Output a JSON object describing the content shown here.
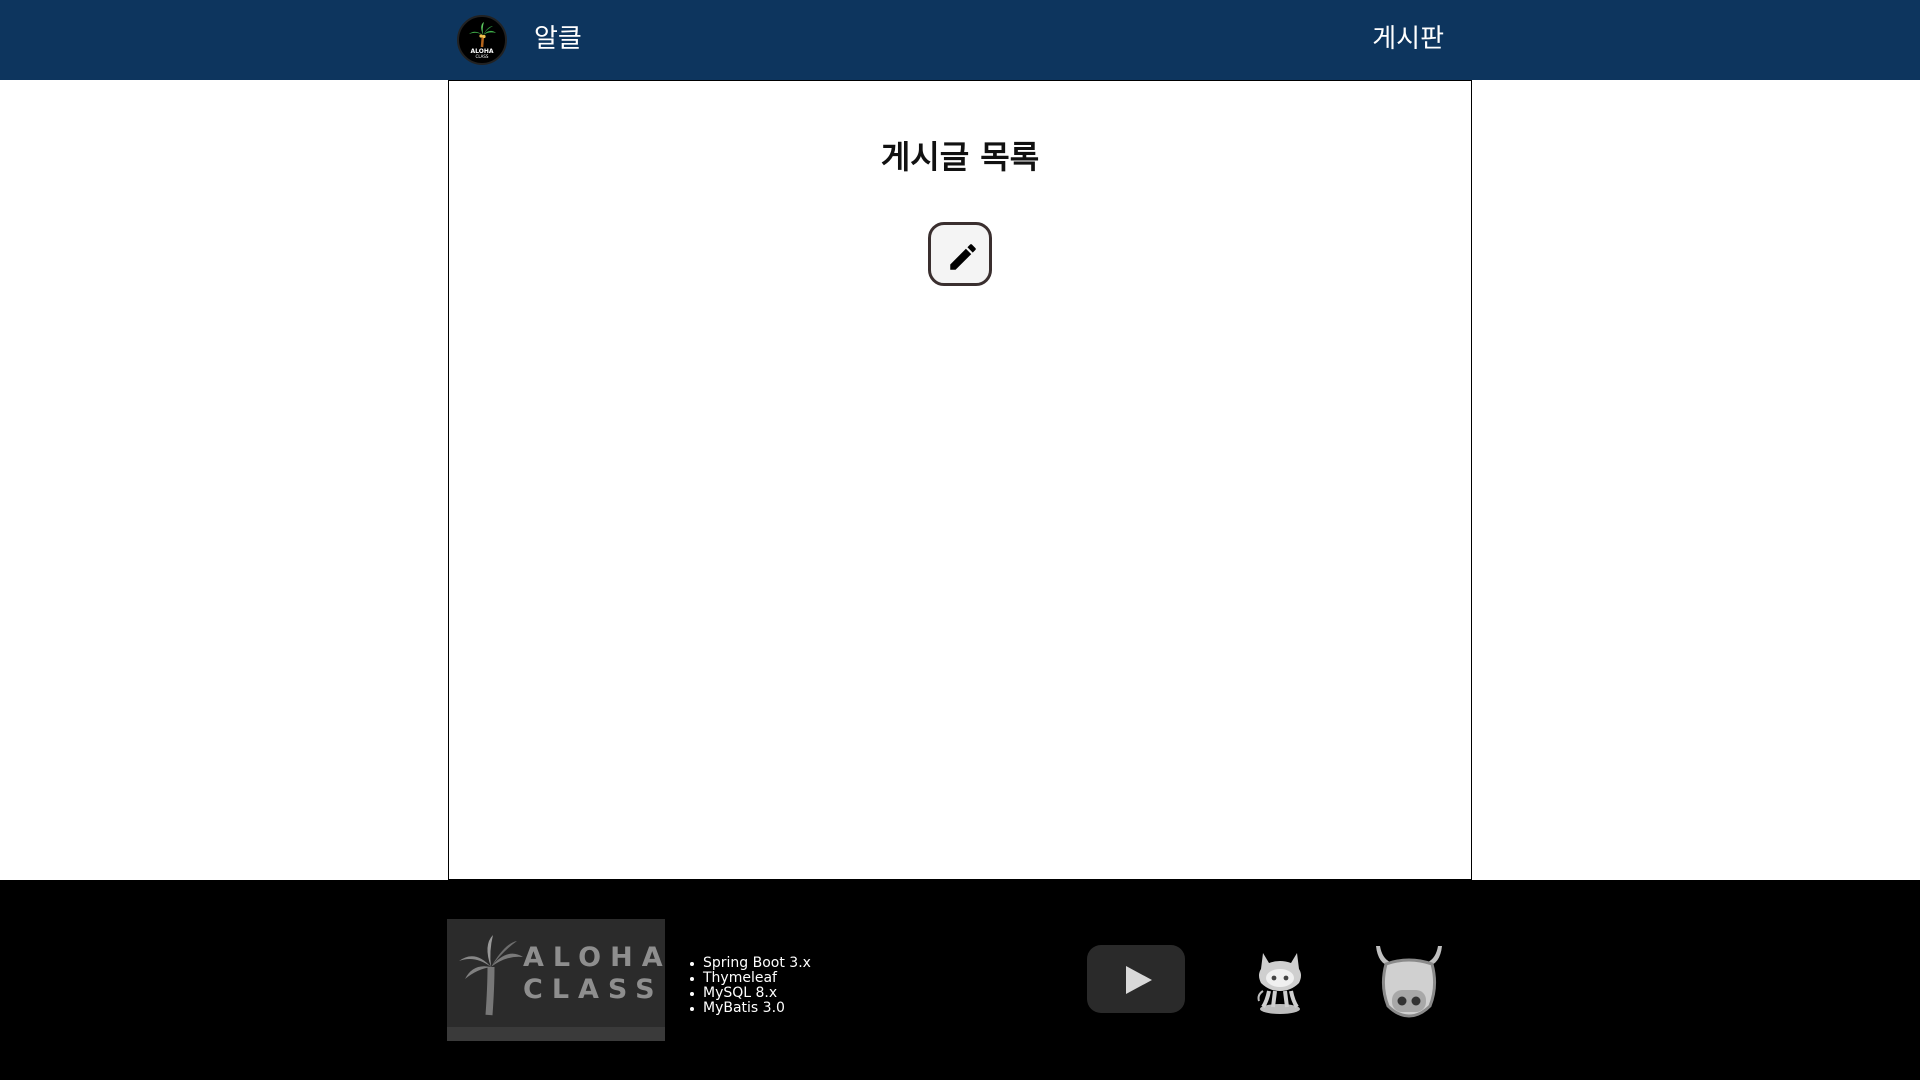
{
  "header": {
    "logo_text": "ALOHA",
    "logo_sub": "CLASS",
    "brand": "알클",
    "nav_board": "게시판"
  },
  "main": {
    "title": "게시글 목록",
    "write_icon": "pencil-icon"
  },
  "footer": {
    "logo_line1": "ALOHA",
    "logo_line2": "CLASS",
    "stack": [
      "Spring Boot 3.x",
      "Thymeleaf",
      "MySQL 8.x",
      "MyBatis 3.0"
    ],
    "social_icons": [
      "youtube-icon",
      "github-icon",
      "cow-icon"
    ]
  },
  "colors": {
    "header_bg": "#0d355e",
    "footer_bg": "#000000"
  }
}
